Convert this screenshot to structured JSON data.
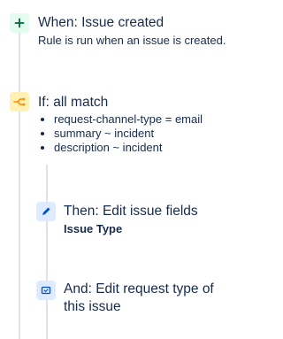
{
  "trigger": {
    "title": "When: Issue created",
    "description": "Rule is run when an issue is created.",
    "icon": "plus-icon"
  },
  "condition": {
    "title": "If: all match",
    "icon": "branch-icon",
    "items": [
      "request-channel-type = email",
      "summary ~ incident",
      "description ~ incident"
    ]
  },
  "actions": [
    {
      "title": "Then: Edit issue fields",
      "description": "Issue Type",
      "icon": "pencil-icon"
    },
    {
      "title": "And: Edit request type of this issue",
      "icon": "request-type-icon"
    }
  ],
  "colors": {
    "trigger_bg": "#e3fcef",
    "trigger_fg": "#006644",
    "condition_bg": "#fff0b3",
    "condition_fg": "#ff8b00",
    "action_bg": "#deebff",
    "action_fg": "#0052cc",
    "rail": "#dfe1e6"
  }
}
